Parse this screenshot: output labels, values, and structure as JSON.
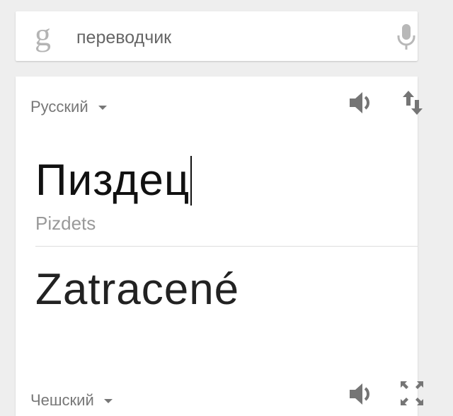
{
  "search": {
    "logo": "g",
    "query": "переводчик",
    "mic_icon": "microphone-icon"
  },
  "translator": {
    "source_language": "Русский",
    "target_language": "Чешский",
    "source_text": "Пиздец",
    "transliteration": "Pizdets",
    "translation": "Zatracené",
    "icons": {
      "source_speak": "speaker-icon",
      "swap": "swap-languages-icon",
      "target_speak": "speaker-icon",
      "fullscreen": "fullscreen-icon"
    }
  },
  "colors": {
    "background": "#eeeeee",
    "card": "#ffffff",
    "icon": "#757575",
    "muted_text": "#777777"
  }
}
